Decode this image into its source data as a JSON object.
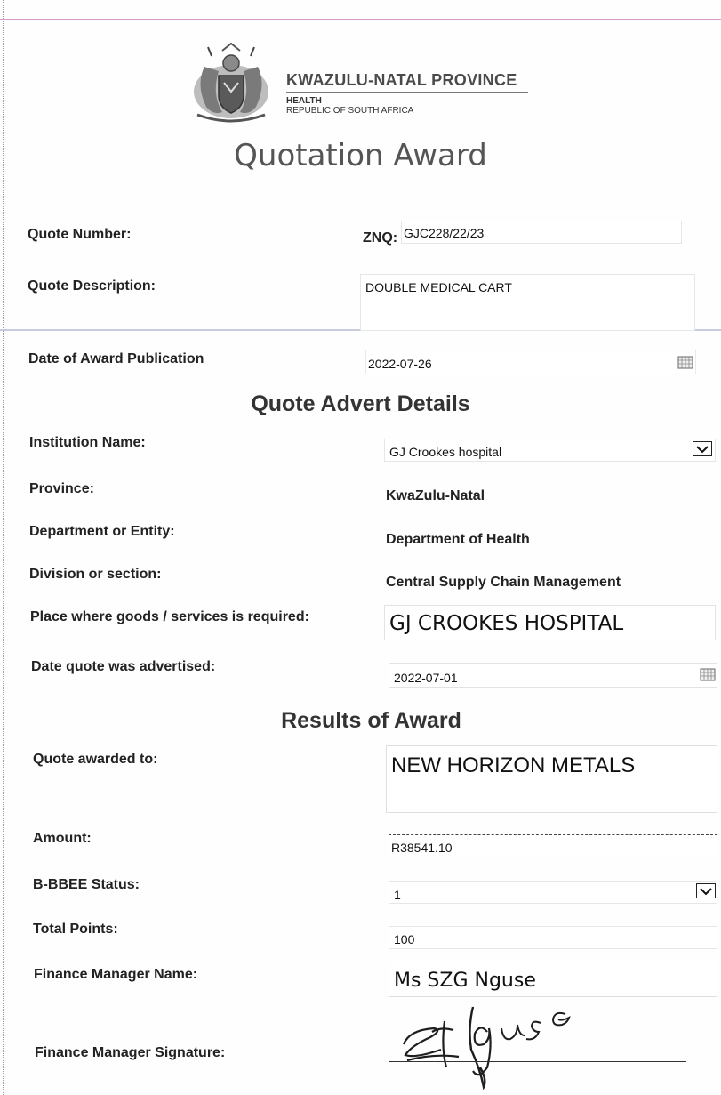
{
  "header": {
    "org_name": "KWAZULU-NATAL PROVINCE",
    "org_dept": "HEALTH",
    "org_country": "REPUBLIC OF SOUTH AFRICA",
    "title": "Quotation Award"
  },
  "quote": {
    "number_label": "Quote Number:",
    "number_prefix": "ZNQ:",
    "number_value": "GJC228/22/23",
    "description_label": "Quote Description:",
    "description_value": "DOUBLE MEDICAL CART",
    "publication_label": "Date of Award Publication",
    "publication_value": "2022-07-26"
  },
  "advert": {
    "heading": "Quote Advert Details",
    "institution_label": "Institution Name:",
    "institution_value": "GJ Crookes hospital",
    "province_label": "Province:",
    "province_value": "KwaZulu-Natal",
    "department_label": "Department or Entity:",
    "department_value": "Department of Health",
    "division_label": "Division or section:",
    "division_value": "Central Supply Chain Management",
    "place_label": "Place where goods /  services is required:",
    "place_value": "GJ CROOKES HOSPITAL",
    "advertised_label": "Date quote was advertised:",
    "advertised_value": "2022-07-01"
  },
  "results": {
    "heading": "Results of Award",
    "awarded_label": "Quote awarded to:",
    "awarded_value": "NEW HORIZON METALS",
    "amount_label": "Amount:",
    "amount_value": "R38541.10",
    "bbbee_label": "B-BBEE Status:",
    "bbbee_value": "1",
    "points_label": "Total Points:",
    "points_value": "100",
    "manager_label": "Finance Manager Name:",
    "manager_value": "Ms SZG Nguse",
    "signature_label": "Finance Manager Signature:",
    "signature_text": "Nguse"
  },
  "icons": {
    "crest": "coat-of-arms-icon",
    "dropdown": "chevron-down-icon",
    "calendar": "calendar-icon"
  },
  "colors": {
    "top_rule": "#b04a9c",
    "text": "#222222"
  }
}
